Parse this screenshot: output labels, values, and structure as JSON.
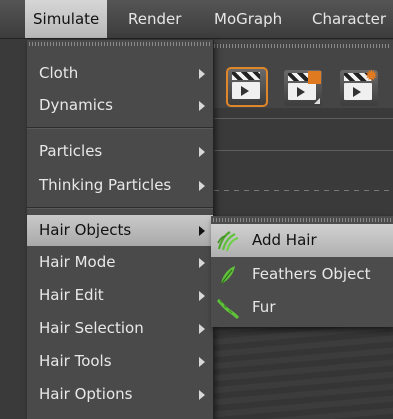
{
  "menubar": {
    "items": [
      {
        "label": "Simulate",
        "active": true
      },
      {
        "label": "Render"
      },
      {
        "label": "MoGraph"
      },
      {
        "label": "Character"
      }
    ]
  },
  "simulate_menu": {
    "items": [
      {
        "label": "Cloth",
        "has_submenu": true
      },
      {
        "label": "Dynamics",
        "has_submenu": true
      },
      {
        "label": "Particles",
        "has_submenu": true
      },
      {
        "label": "Thinking Particles",
        "has_submenu": true
      },
      {
        "label": "Hair Objects",
        "has_submenu": true,
        "highlighted": true
      },
      {
        "label": "Hair Mode",
        "has_submenu": true
      },
      {
        "label": "Hair Edit",
        "has_submenu": true
      },
      {
        "label": "Hair Selection",
        "has_submenu": true
      },
      {
        "label": "Hair Tools",
        "has_submenu": true
      },
      {
        "label": "Hair Options",
        "has_submenu": true
      }
    ]
  },
  "hair_objects_submenu": {
    "items": [
      {
        "label": "Add Hair",
        "icon": "add-hair-icon",
        "highlighted": true
      },
      {
        "label": "Feathers Object",
        "icon": "feather-icon"
      },
      {
        "label": "Fur",
        "icon": "fur-icon"
      }
    ]
  },
  "toolbar": {
    "icons": [
      "render-view-icon",
      "render-region-icon",
      "render-settings-icon"
    ]
  },
  "colors": {
    "accent": "#e07a20",
    "icon_green": "#5fc23a",
    "menu_bg": "#4a4a4a",
    "highlight": "#c0c0c0"
  }
}
